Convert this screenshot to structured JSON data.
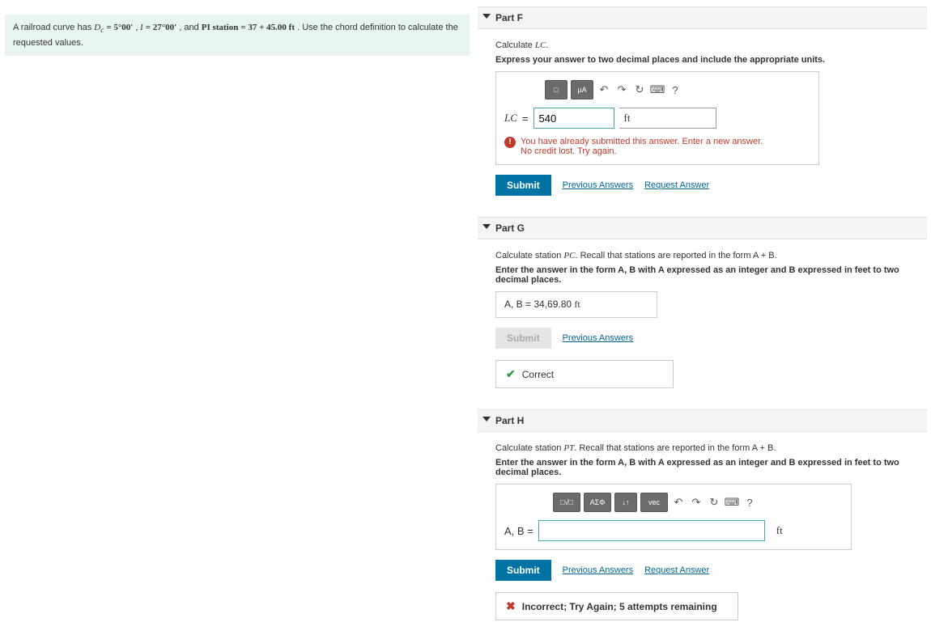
{
  "problem": {
    "prefix": "A railroad curve has ",
    "dc_var": "D",
    "dc_sub": "c",
    "dc_val": " = 5°00′",
    "i_label": ", I",
    "i_val": " = 27°00′",
    "pi_label": ", and PI station",
    "pi_val": " = 37 + 45.00 ft",
    "suffix": ". Use the chord definition to calculate the requested values."
  },
  "partF": {
    "header": "Part F",
    "line1_a": "Calculate ",
    "line1_var": "LC",
    "line1_b": ".",
    "line2": "Express your answer to two decimal places and include the appropriate units.",
    "toolbar": {
      "t1": "□",
      "t2": "µA",
      "undo": "↶",
      "redo": "↷",
      "reset": "↻",
      "kb": "⌨",
      "help": "?"
    },
    "eq_label": "LC",
    "eq_eq": " = ",
    "value": "540",
    "unit": "ft",
    "warn_l1": "You have already submitted this answer. Enter a new answer.",
    "warn_l2": "No credit lost. Try again.",
    "submit": "Submit",
    "prev": "Previous Answers",
    "req": "Request Answer"
  },
  "partG": {
    "header": "Part G",
    "line1_a": "Calculate station ",
    "line1_var": "PC",
    "line1_b": ". Recall that stations are reported in the form A + B.",
    "line2": "Enter the answer in the form A, B with A expressed as an integer and B expressed in feet to two decimal places.",
    "ans_label": "A, B = ",
    "ans_value": "34,69.80",
    "ans_unit": " ft",
    "submit": "Submit",
    "prev": "Previous Answers",
    "correct": "Correct"
  },
  "partH": {
    "header": "Part H",
    "line1_a": "Calculate station ",
    "line1_var": "PT",
    "line1_b": ". Recall that stations are reported in the form A + B.",
    "line2": "Enter the answer in the form A, B with A expressed as an integer and B expressed in feet to two decimal places.",
    "toolbar": {
      "t1": "□√□",
      "t2": "ΑΣΦ",
      "t3": "↓↑",
      "t4": "vec",
      "undo": "↶",
      "redo": "↷",
      "reset": "↻",
      "kb": "⌨",
      "help": "?"
    },
    "eq_label": "A, B = ",
    "value": "",
    "unit": "ft",
    "submit": "Submit",
    "prev": "Previous Answers",
    "req": "Request Answer",
    "incorrect": "Incorrect; Try Again; 5 attempts remaining"
  }
}
